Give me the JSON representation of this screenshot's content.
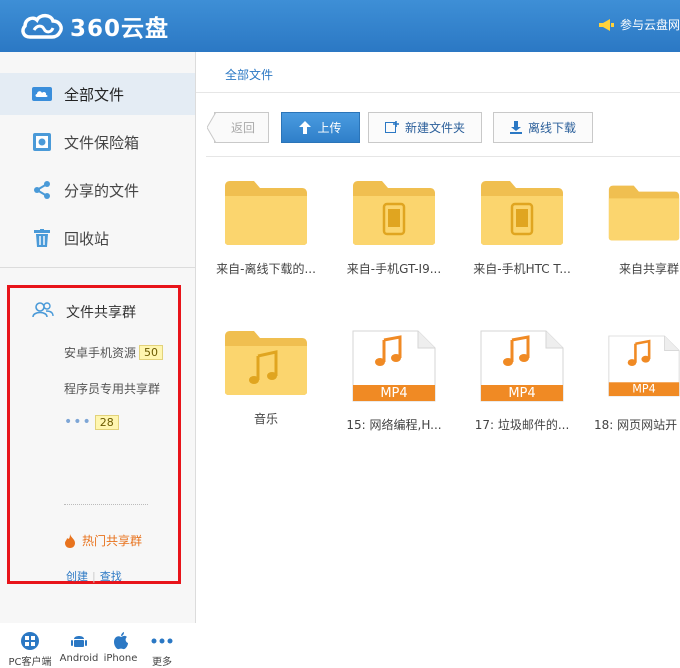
{
  "header": {
    "logo_text": "360云盘",
    "notice": "参与云盘网",
    "brand_color": "#2b78c4"
  },
  "sidebar": {
    "items": [
      {
        "label": "全部文件",
        "icon": "cloud-icon",
        "active": true
      },
      {
        "label": "文件保险箱",
        "icon": "safe-icon",
        "active": false
      },
      {
        "label": "分享的文件",
        "icon": "share-icon",
        "active": false
      },
      {
        "label": "回收站",
        "icon": "trash-icon",
        "active": false
      }
    ],
    "share_groups": {
      "title": "文件共享群",
      "groups": [
        {
          "name": "安卓手机资源",
          "count": "50"
        },
        {
          "name": "程序员专用共享群",
          "count": ""
        }
      ],
      "more_count": "28",
      "hot_label": "热门共享群",
      "create_label": "创建",
      "find_label": "查找"
    },
    "clients": [
      {
        "label": "PC客户端",
        "icon": "windows-icon"
      },
      {
        "label": "Android",
        "icon": "android-icon"
      },
      {
        "label": "iPhone",
        "icon": "apple-icon"
      },
      {
        "label": "更多",
        "icon": "more-icon"
      }
    ]
  },
  "main": {
    "breadcrumb": "全部文件",
    "toolbar": {
      "back": "返回",
      "upload": "上传",
      "new_folder": "新建文件夹",
      "offline_download": "离线下载"
    },
    "files": [
      {
        "name": "来自-离线下载的...",
        "type": "folder",
        "overlay": ""
      },
      {
        "name": "来自-手机GT-I9...",
        "type": "folder",
        "overlay": "phone"
      },
      {
        "name": "来自-手机HTC T...",
        "type": "folder",
        "overlay": "phone"
      },
      {
        "name": "来自共享群",
        "type": "folder",
        "overlay": ""
      },
      {
        "name": "音乐",
        "type": "folder",
        "overlay": "music"
      },
      {
        "name": "15: 网络编程,H...",
        "type": "mp4",
        "overlay": "MP4"
      },
      {
        "name": "17: 垃圾邮件的...",
        "type": "mp4",
        "overlay": "MP4"
      },
      {
        "name": "18: 网页网站开",
        "type": "mp4",
        "overlay": "MP4"
      }
    ]
  }
}
